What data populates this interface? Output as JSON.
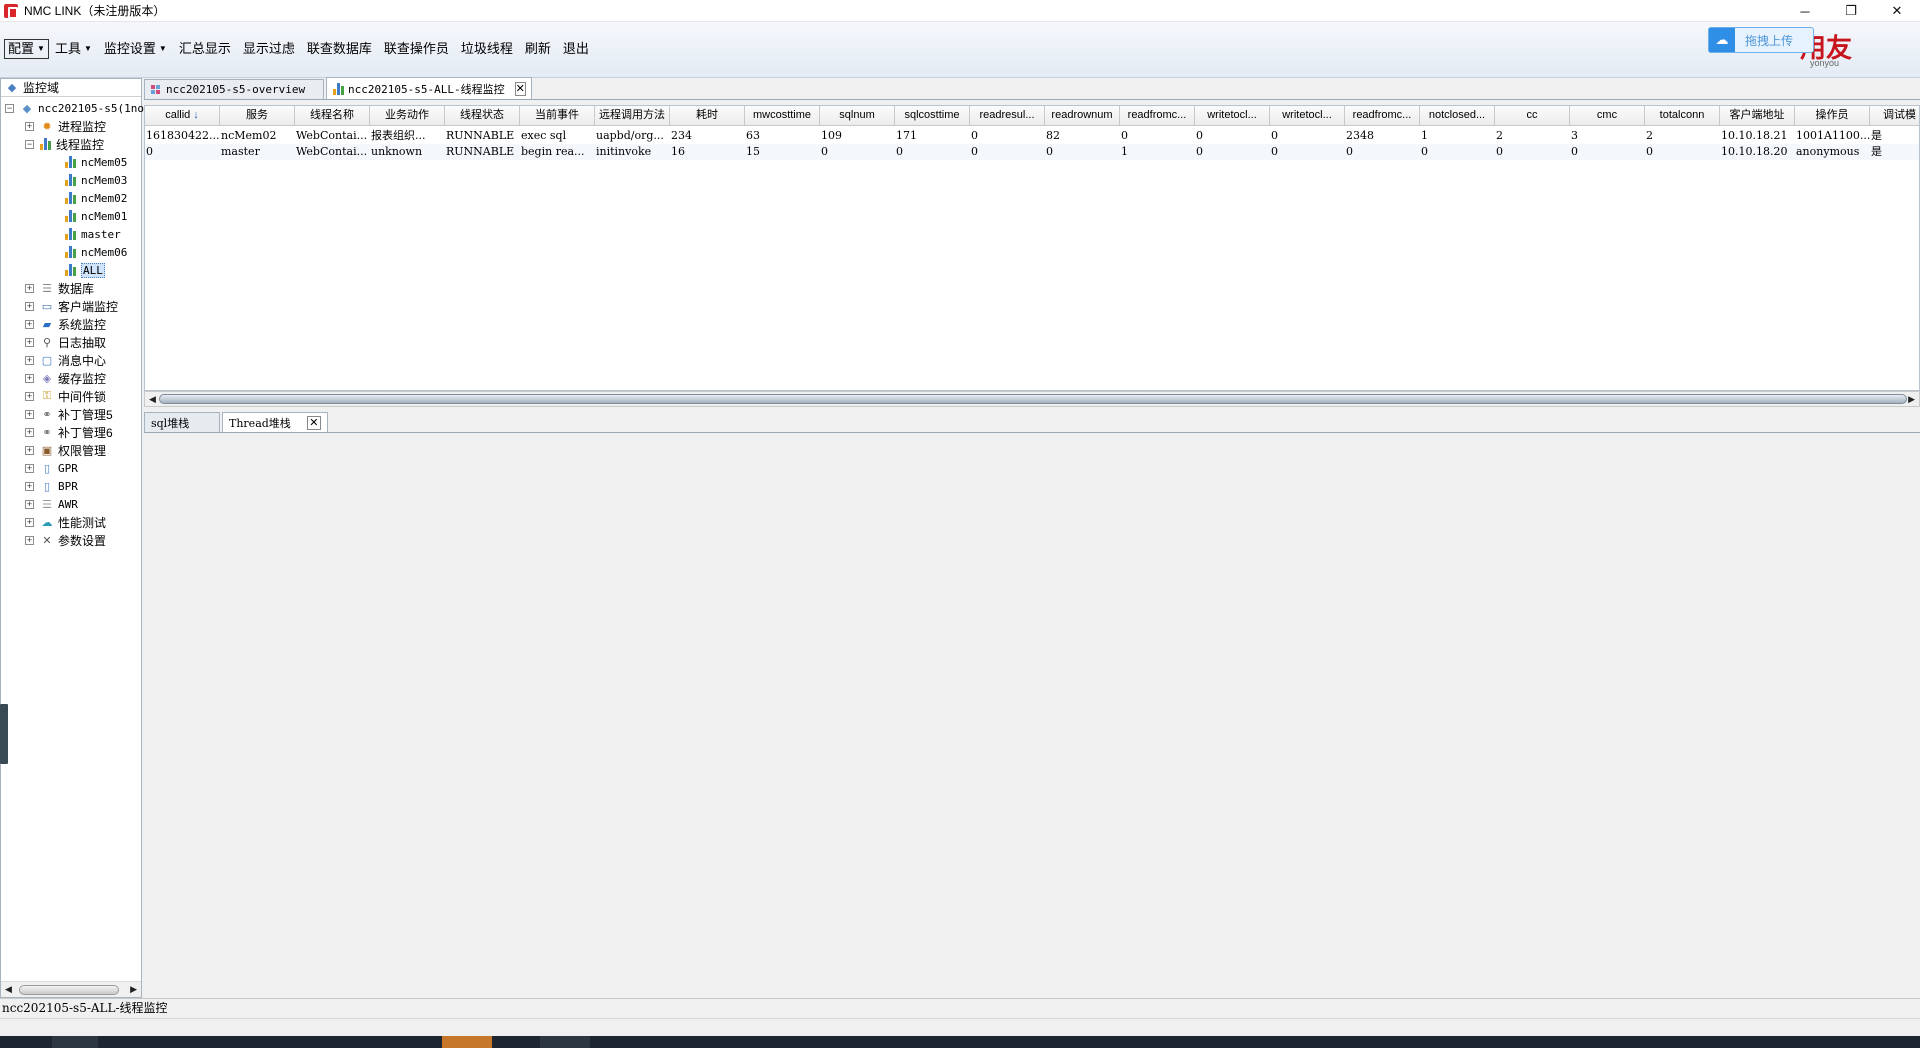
{
  "window": {
    "title": "NMC LINK（未注册版本）",
    "controls": {
      "minimize": "─",
      "restore": "❐",
      "close": "✕"
    }
  },
  "menu": {
    "items": [
      {
        "label": "配置",
        "has_dropdown": true
      },
      {
        "label": "工具",
        "has_dropdown": true
      },
      {
        "label": "监控设置",
        "has_dropdown": true
      },
      {
        "label": "汇总显示",
        "has_dropdown": false
      },
      {
        "label": "显示过虑",
        "has_dropdown": false
      },
      {
        "label": "联查数据库",
        "has_dropdown": false
      },
      {
        "label": "联查操作员",
        "has_dropdown": false
      },
      {
        "label": "垃圾线程",
        "has_dropdown": false
      },
      {
        "label": "刷新",
        "has_dropdown": false
      },
      {
        "label": "退出",
        "has_dropdown": false
      }
    ],
    "upload_label": "拖拽上传",
    "brand_text": "用友",
    "brand_sub": "yonyou"
  },
  "tree": {
    "header": "监控域",
    "root": "ncc202105-s5(1no",
    "nodes": [
      {
        "label": "进程监控",
        "expander": "+",
        "icon": "gear-sun-icon"
      },
      {
        "label": "线程监控",
        "expander": "−",
        "icon": "bar-chart-icon"
      }
    ],
    "thread_children": [
      "ncMem05",
      "ncMem03",
      "ncMem02",
      "ncMem01",
      "master",
      "ncMem06",
      "ALL"
    ],
    "selected_child": "ALL",
    "more_nodes": [
      {
        "label": "数据库",
        "icon": "database-icon"
      },
      {
        "label": "客户端监控",
        "icon": "monitor-icon"
      },
      {
        "label": "系统监控",
        "icon": "system-icon"
      },
      {
        "label": "日志抽取",
        "icon": "search-icon"
      },
      {
        "label": "消息中心",
        "icon": "message-icon"
      },
      {
        "label": "缓存监控",
        "icon": "cache-icon"
      },
      {
        "label": "中间件锁",
        "icon": "lock-icon"
      },
      {
        "label": "补丁管理5",
        "icon": "patch-icon"
      },
      {
        "label": "补丁管理6",
        "icon": "patch-icon"
      },
      {
        "label": "权限管理",
        "icon": "permission-icon"
      },
      {
        "label": "GPR",
        "icon": "doc-icon"
      },
      {
        "label": "BPR",
        "icon": "doc-icon"
      },
      {
        "label": "AWR",
        "icon": "list-icon"
      },
      {
        "label": "性能测试",
        "icon": "cloud-icon"
      },
      {
        "label": "参数设置",
        "icon": "tools-icon"
      }
    ]
  },
  "tabs": [
    {
      "label": "ncc202105-s5-overview",
      "active": false
    },
    {
      "label": "ncc202105-s5-ALL-线程监控",
      "active": true
    }
  ],
  "table": {
    "columns": [
      "callid",
      "服务",
      "线程名称",
      "业务动作",
      "线程状态",
      "当前事件",
      "远程调用方法",
      "耗时",
      "mwcosttime",
      "sqlnum",
      "sqlcosttime",
      "readresul...",
      "readrownum",
      "readfromc...",
      "writetocl...",
      "writetocl...",
      "readfromc...",
      "notclosed...",
      "cc",
      "cmc",
      "totalconn",
      "客户端地址",
      "操作员",
      "调试模"
    ],
    "sort_column": "callid",
    "sort_indicator": "↓",
    "rows": [
      [
        "161830422...",
        "ncMem02",
        "WebContai...",
        "报表组织...",
        "RUNNABLE",
        "exec sql",
        "uapbd/org...",
        "234",
        "63",
        "109",
        "171",
        "0",
        "82",
        "0",
        "0",
        "0",
        "2348",
        "1",
        "2",
        "3",
        "2",
        "10.10.18.21",
        "1001A1100...",
        "是"
      ],
      [
        "0",
        "master",
        "WebContai...",
        "unknown",
        "RUNNABLE",
        "begin rea...",
        "initinvoke",
        "16",
        "15",
        "0",
        "0",
        "0",
        "0",
        "1",
        "0",
        "0",
        "0",
        "0",
        "0",
        "0",
        "0",
        "10.10.18.20",
        "anonymous",
        "是"
      ]
    ]
  },
  "sub_tabs": [
    {
      "label": "sql堆栈",
      "active": false
    },
    {
      "label": "Thread堆栈",
      "active": true
    }
  ],
  "status": {
    "text": "ncc202105-s5-ALL-线程监控"
  },
  "colors": {
    "menubar": "#e4ebf4",
    "accent": "#2f8fe6",
    "brand": "#c8151d"
  }
}
